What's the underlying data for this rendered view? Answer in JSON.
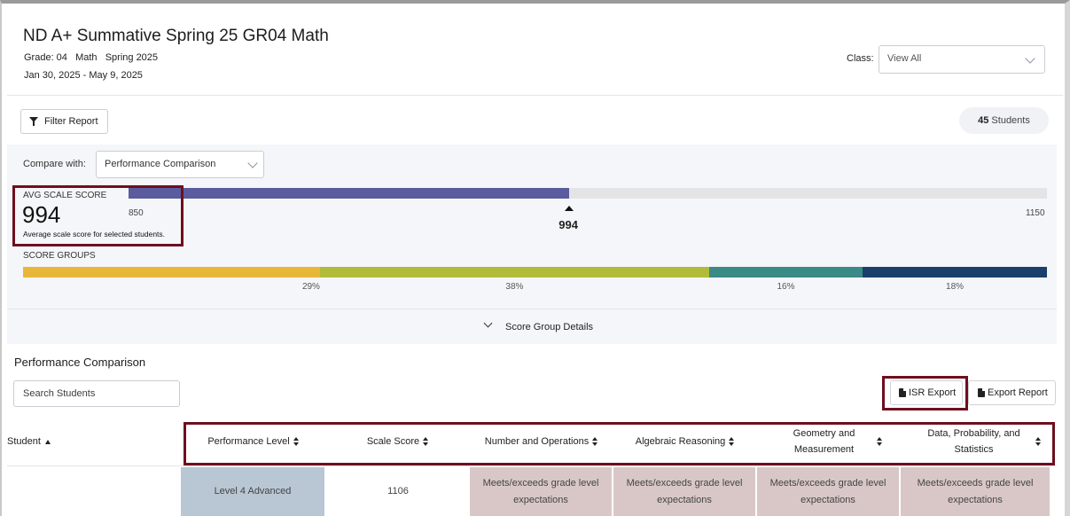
{
  "header": {
    "title": "ND A+ Summative Spring 25 GR04 Math",
    "meta_line": "Grade: 04   Math   Spring 2025",
    "date_range": "Jan 30, 2025 - May 9, 2025",
    "class_label": "Class:",
    "class_value": "View All"
  },
  "filter": {
    "button_label": "Filter Report",
    "student_count": "45",
    "student_suffix": " Students"
  },
  "compare": {
    "label": "Compare with:",
    "value": "Performance Comparison"
  },
  "avg_scale_score": {
    "label": "AVG SCALE SCORE",
    "value": "994",
    "description": "Average scale score for selected students.",
    "min_label": "850",
    "max_label": "1150",
    "min": 850,
    "max": 1150,
    "score": 994,
    "fill_color": "#5a5c9e"
  },
  "score_groups": {
    "label": "SCORE GROUPS",
    "groups": [
      {
        "pct_label": "29%",
        "share": 29,
        "color": "#e8b73a"
      },
      {
        "pct_label": "38%",
        "share": 38,
        "color": "#b1bc3a"
      },
      {
        "pct_label": "16%",
        "share": 15,
        "color": "#3a8a86"
      },
      {
        "pct_label": "18%",
        "share": 18,
        "color": "#1a3f6c"
      }
    ]
  },
  "details_toggle": "Score Group Details",
  "performance": {
    "title": "Performance Comparison",
    "search_placeholder": "Search Students",
    "isr_export": "ISR Export",
    "export_report": "Export Report",
    "columns": [
      "Student",
      "Performance Level",
      "Scale Score",
      "Number and Operations",
      "Algebraic Reasoning",
      "Geometry and Measurement",
      "Data, Probability, and Statistics"
    ],
    "rows": [
      {
        "student": "",
        "performance_level": "Level 4 Advanced",
        "scale_score": "1106",
        "number_operations": "Meets/exceeds grade level expectations",
        "algebraic_reasoning": "Meets/exceeds grade level expectations",
        "geometry_measurement": "Meets/exceeds grade level expectations",
        "data_probability": "Meets/exceeds grade level expectations"
      }
    ],
    "colors": {
      "level_cell": "#b9c7d4",
      "meets_cell": "#d9c7c7",
      "highlight": "#6e0f1f"
    }
  }
}
